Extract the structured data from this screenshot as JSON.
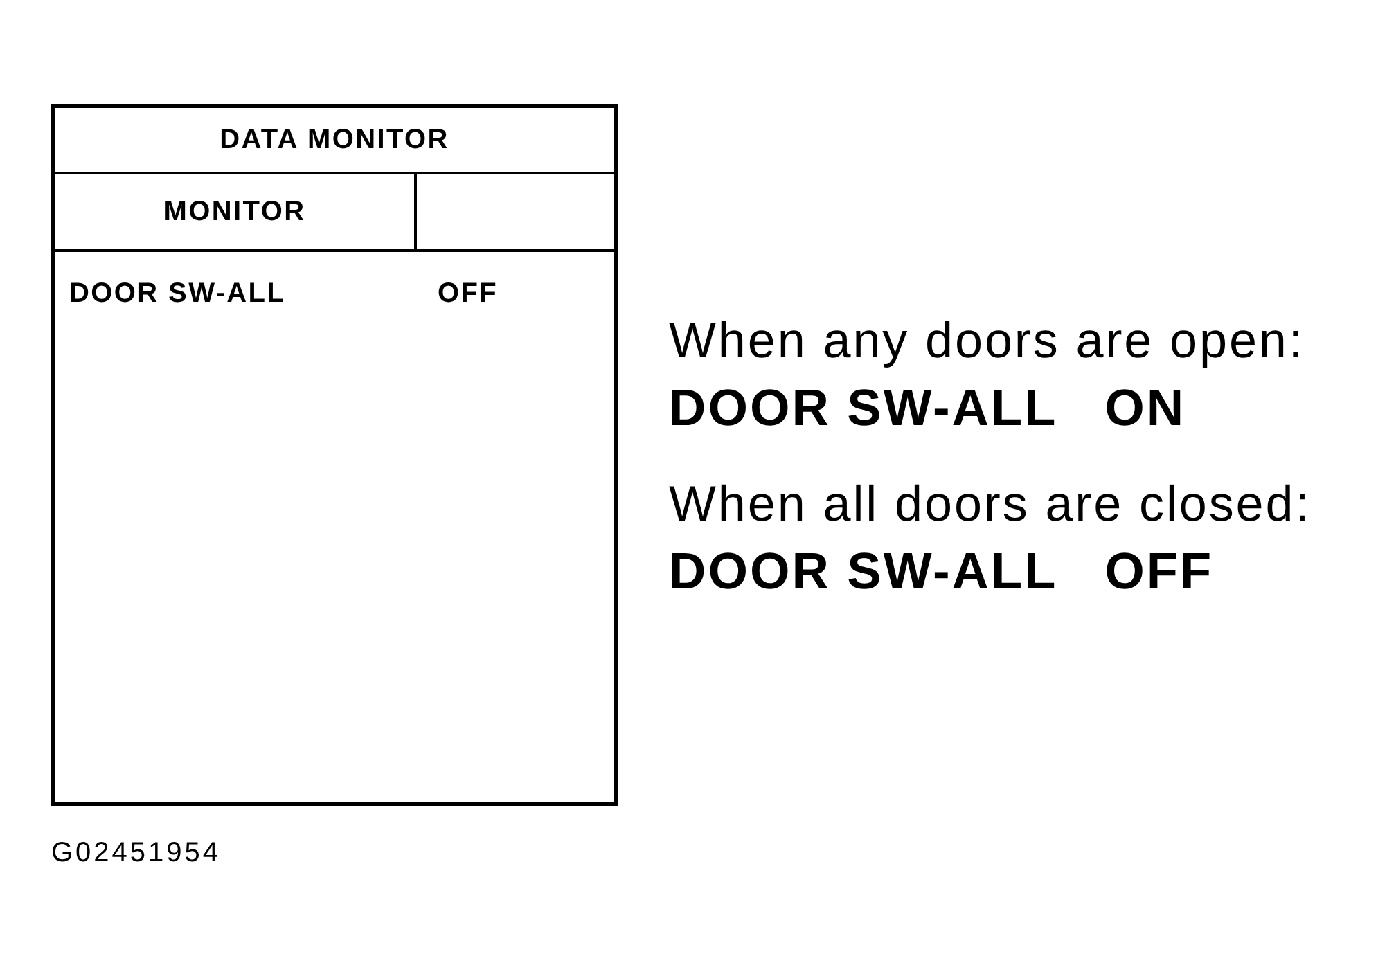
{
  "monitor_table": {
    "title": "DATA MONITOR",
    "columns": [
      "MONITOR"
    ],
    "rows": [
      {
        "item": "DOOR SW-ALL",
        "value": "OFF"
      }
    ]
  },
  "conditions": [
    {
      "condition": "When any doors are open:",
      "item": "DOOR SW-ALL",
      "value": "ON"
    },
    {
      "condition": "When all doors are closed:",
      "item": "DOOR SW-ALL",
      "value": "OFF"
    }
  ],
  "figure_id": "G02451954"
}
